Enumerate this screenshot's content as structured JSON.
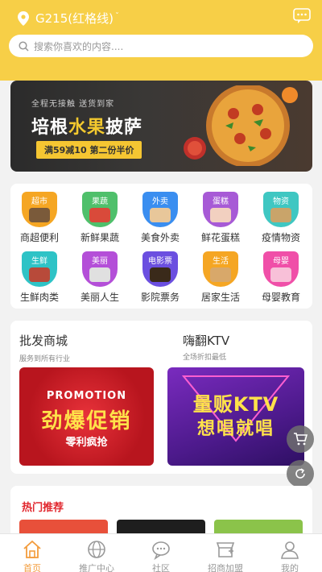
{
  "header": {
    "location": "G215(红格线)",
    "caret": "ˇ",
    "search_placeholder": "搜索你喜欢的内容....",
    "accent": "#f7cf47"
  },
  "banner": {
    "subtitle": "全程无接触 送货到家",
    "title_a": "培根",
    "title_b": "水果",
    "title_c": "披萨",
    "tag": "满59减10 第二份半价"
  },
  "categories": [
    {
      "badge": "超市",
      "name": "商超便利",
      "color": "#f5a623"
    },
    {
      "badge": "果蔬",
      "name": "新鲜果蔬",
      "color": "#4fc06b"
    },
    {
      "badge": "外卖",
      "name": "美食外卖",
      "color": "#3a8ef0"
    },
    {
      "badge": "蛋糕",
      "name": "鲜花蛋糕",
      "color": "#a75ad6"
    },
    {
      "badge": "物资",
      "name": "疫情物资",
      "color": "#3fc7c2"
    },
    {
      "badge": "生鲜",
      "name": "生鲜肉类",
      "color": "#2ec3c6"
    },
    {
      "badge": "美丽",
      "name": "美丽人生",
      "color": "#b44fd8"
    },
    {
      "badge": "电影票",
      "name": "影院票务",
      "color": "#6b4fe0"
    },
    {
      "badge": "生活",
      "name": "居家生活",
      "color": "#f5a623"
    },
    {
      "badge": "母婴",
      "name": "母婴教育",
      "color": "#f04fa8"
    }
  ],
  "promo": [
    {
      "title": "批发商城",
      "subtitle": "服务到所有行业",
      "img_a": "PROMOTION",
      "img_b": "劲爆促销",
      "img_c": "零利疯抢"
    },
    {
      "title": "嗨翻KTV",
      "subtitle": "全场折扣最低",
      "img_a": "量贩KTV",
      "img_b": "想唱就唱"
    }
  ],
  "hot": {
    "title": "热门推荐"
  },
  "tabs": [
    {
      "label": "首页",
      "icon": "home-icon",
      "active": true
    },
    {
      "label": "推广中心",
      "icon": "globe-icon",
      "active": false
    },
    {
      "label": "社区",
      "icon": "chat-icon",
      "active": false
    },
    {
      "label": "招商加盟",
      "icon": "store-icon",
      "active": false
    },
    {
      "label": "我的",
      "icon": "user-icon",
      "active": false
    }
  ]
}
